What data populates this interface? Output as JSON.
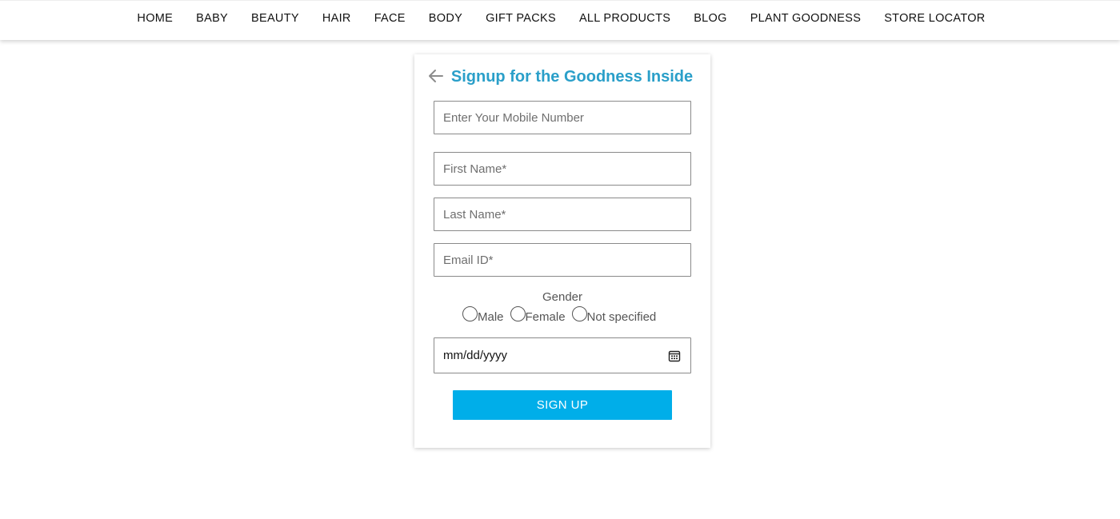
{
  "nav": {
    "items": [
      {
        "label": "HOME"
      },
      {
        "label": "BABY"
      },
      {
        "label": "BEAUTY"
      },
      {
        "label": "HAIR"
      },
      {
        "label": "FACE"
      },
      {
        "label": "BODY"
      },
      {
        "label": "GIFT PACKS"
      },
      {
        "label": "ALL PRODUCTS"
      },
      {
        "label": "BLOG"
      },
      {
        "label": "PLANT GOODNESS"
      },
      {
        "label": "STORE LOCATOR"
      }
    ]
  },
  "signup": {
    "back_icon": "arrow-left-icon",
    "title": "Signup for the Goodness Inside",
    "mobile_placeholder": "Enter Your Mobile Number",
    "first_name_placeholder": "First Name*",
    "last_name_placeholder": "Last Name*",
    "email_placeholder": "Email ID*",
    "gender_label": "Gender",
    "gender_options": [
      {
        "label": "Male"
      },
      {
        "label": "Female"
      },
      {
        "label": "Not specified"
      }
    ],
    "dob_placeholder": "mm/dd/yyyy",
    "calendar_icon": "calendar-icon",
    "submit_label": "SIGN UP"
  },
  "colors": {
    "title": "#2a9fc9",
    "button": "#00aee9",
    "nav_text": "#111111"
  }
}
